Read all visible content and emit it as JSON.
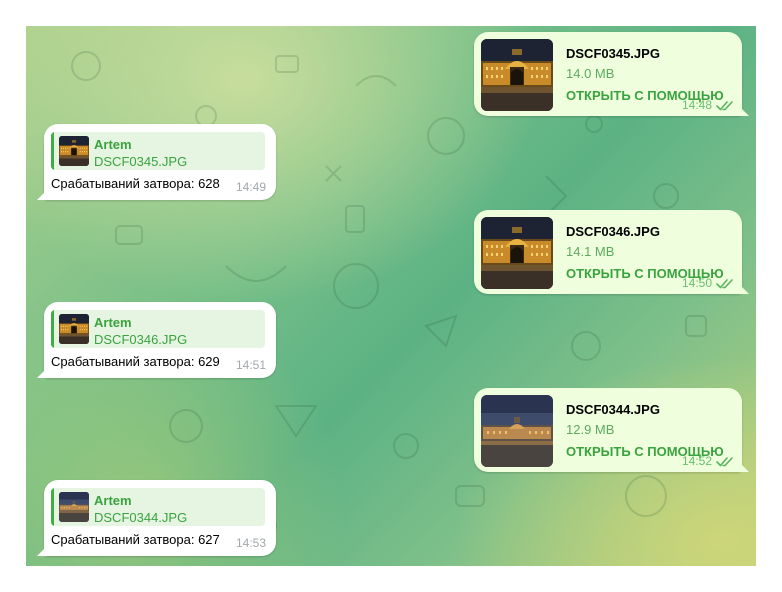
{
  "incoming": [
    {
      "sender": "Artem",
      "file": "DSCF0345.JPG",
      "text": "Срабатываний затвора: 628",
      "time": "14:49"
    },
    {
      "sender": "Artem",
      "file": "DSCF0346.JPG",
      "text": "Срабатываний затвора: 629",
      "time": "14:51"
    },
    {
      "sender": "Artem",
      "file": "DSCF0344.JPG",
      "text": "Срабатываний затвора: 627",
      "time": "14:53"
    }
  ],
  "outgoing": [
    {
      "file": "DSCF0345.JPG",
      "size": "14.0 MB",
      "action": "ОТКРЫТЬ С ПОМОЩЬЮ",
      "time": "14:48"
    },
    {
      "file": "DSCF0346.JPG",
      "size": "14.1 MB",
      "action": "ОТКРЫТЬ С ПОМОЩЬЮ",
      "time": "14:50"
    },
    {
      "file": "DSCF0344.JPG",
      "size": "12.9 MB",
      "action": "ОТКРЫТЬ С ПОМОЩЬЮ",
      "time": "14:52"
    }
  ],
  "colors": {
    "accent": "#3aa33f",
    "incoming_bubble": "#ffffff",
    "outgoing_bubble": "#effedd",
    "reply_background": "#e6f4e2"
  }
}
